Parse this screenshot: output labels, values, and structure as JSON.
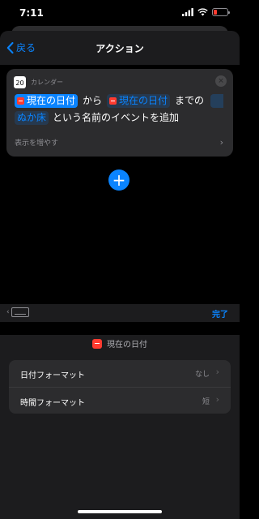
{
  "status": {
    "time": "7:11"
  },
  "nav": {
    "back_label": "戻る",
    "title": "アクション"
  },
  "action_card": {
    "app_icon_day": "20",
    "app_label": "カレンダー",
    "tokens": {
      "start_date": "現在の日付",
      "end_date": "現在の日付",
      "name": "ぬか床"
    },
    "words": {
      "from": "から",
      "until": "までの",
      "suffix": "という名前のイベントを追加"
    },
    "show_more": "表示を増やす"
  },
  "keyboard_toolbar": {
    "done_label": "完了"
  },
  "variable_panel": {
    "title": "現在の日付",
    "rows": [
      {
        "label": "日付フォーマット",
        "value": "なし"
      },
      {
        "label": "時間フォーマット",
        "value": "短"
      }
    ]
  },
  "colors": {
    "accent": "#0a84ff",
    "calendar_red": "#ff3b30",
    "card_bg": "#2c2c2e",
    "sheet_bg": "#1c1c1e"
  }
}
